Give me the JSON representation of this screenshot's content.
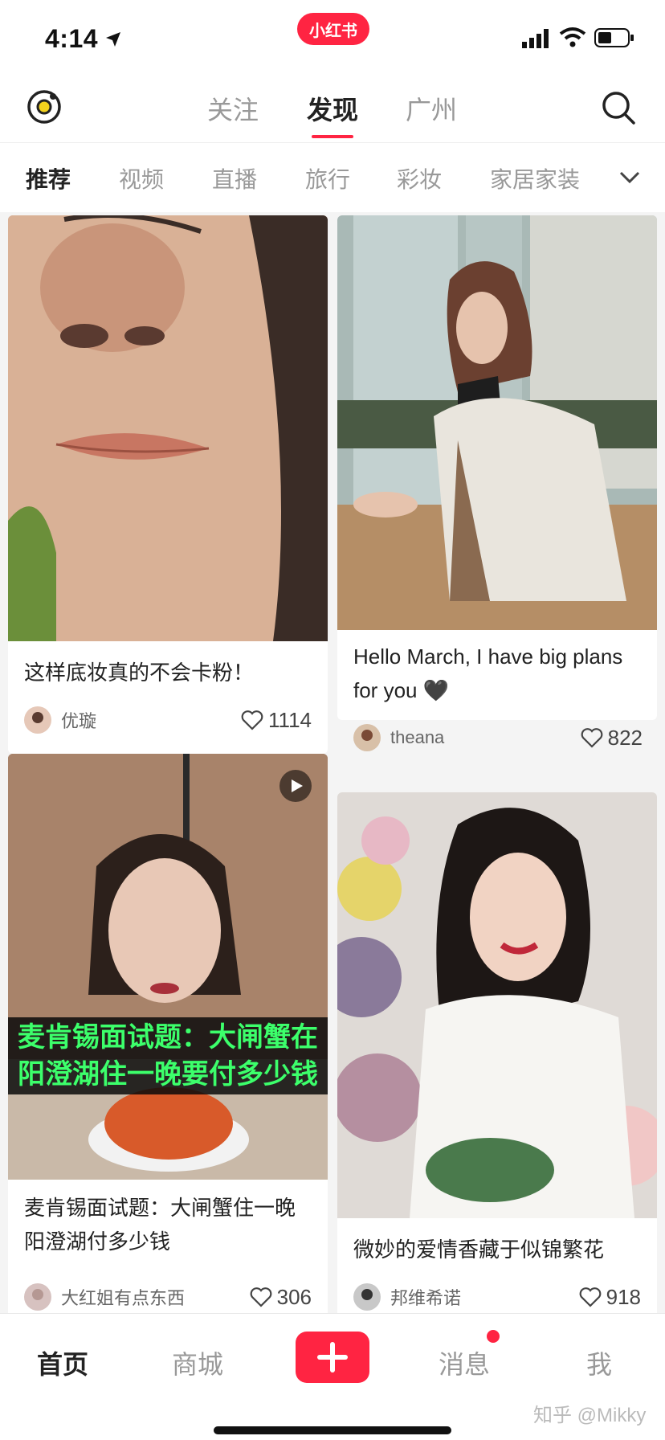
{
  "status_bar": {
    "time": "4:14",
    "app_badge": "小红书"
  },
  "top_nav": {
    "tabs": [
      {
        "label": "关注",
        "active": false
      },
      {
        "label": "发现",
        "active": true
      },
      {
        "label": "广州",
        "active": false
      }
    ]
  },
  "categories": [
    {
      "label": "推荐",
      "active": true
    },
    {
      "label": "视频",
      "active": false
    },
    {
      "label": "直播",
      "active": false
    },
    {
      "label": "旅行",
      "active": false
    },
    {
      "label": "彩妆",
      "active": false
    },
    {
      "label": "家居家装",
      "active": false
    }
  ],
  "feed": {
    "cards": [
      {
        "title": "这样底妆真的不会卡粉！",
        "author": "优璇",
        "likes": "1114",
        "video": false
      },
      {
        "title": "Hello March, I have big plans for you 🖤",
        "author": "theana",
        "likes": "822",
        "video": false
      },
      {
        "title": "麦肯锡面试题：大闸蟹住一晚阳澄湖付多少钱",
        "author": "大红姐有点东西",
        "likes": "306",
        "video": true,
        "overlay": "麦肯锡面试题：大闸蟹在阳澄湖住一晚要付多少钱"
      },
      {
        "title": "微妙的爱情香藏于似锦繁花",
        "author": "邦维希诺",
        "likes": "918",
        "video": false
      }
    ]
  },
  "bottom_nav": {
    "tabs": [
      {
        "label": "首页",
        "active": true
      },
      {
        "label": "商城",
        "active": false
      },
      {
        "label": "消息",
        "active": false
      },
      {
        "label": "我",
        "active": false
      }
    ],
    "watermark": "知乎 @Mikky"
  },
  "colors": {
    "accent": "#ff2442",
    "overlay_text": "#3cff6b"
  }
}
